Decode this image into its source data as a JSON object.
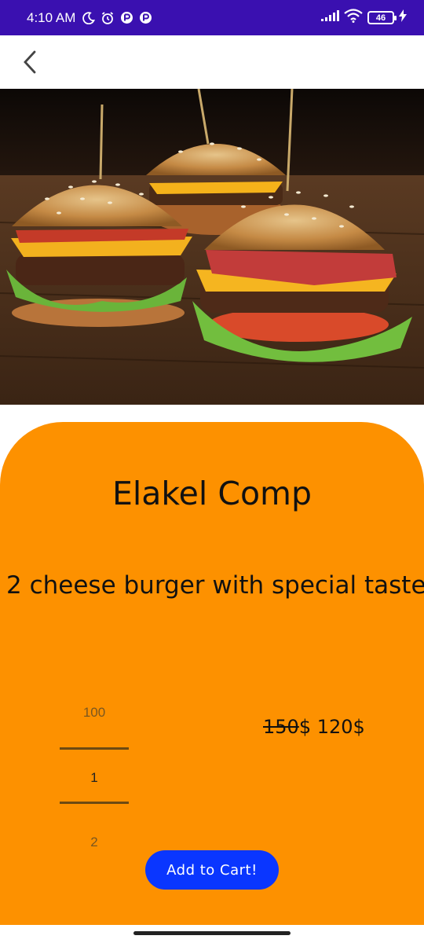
{
  "status_bar": {
    "time": "4:10 AM",
    "battery": "46",
    "icons": [
      "moon-icon",
      "alarm-icon",
      "app-notification-icon",
      "app-notification-icon",
      "signal-icon",
      "wifi-icon",
      "battery-icon",
      "charging-icon"
    ]
  },
  "toolbar": {
    "back_icon": "chevron-left-icon"
  },
  "product": {
    "title": "Elakel Comp",
    "description": "2 cheese burger with special taste",
    "old_price": "150",
    "price_text": "$ 120$"
  },
  "quantity_picker": {
    "previous": "100",
    "current": "1",
    "next": "2"
  },
  "actions": {
    "add_to_cart": "Add to Cart!"
  },
  "colors": {
    "status_bar": "#3a10b0",
    "card": "#fd9100",
    "button": "#0a36ff"
  }
}
